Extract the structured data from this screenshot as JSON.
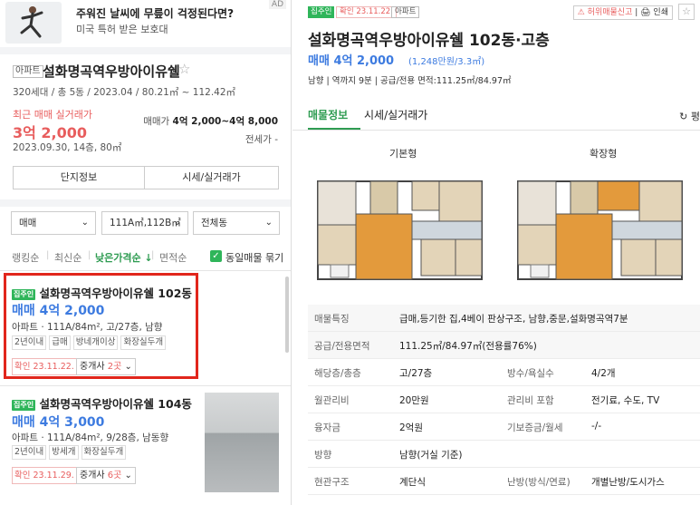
{
  "ad": {
    "badge": "AD",
    "title": "주워진 날씨에 무릎이 걱정된다면?",
    "subtitle": "미국 특허 받은 보호대"
  },
  "complex": {
    "type": "아파트",
    "name": "설화명곡역우방아이유쉘",
    "star": "☆",
    "info": "320세대 / 총 5동 / 2023.04 / 80.21㎡ ~ 112.42㎡",
    "recent_label": "최근 매매 실거래가",
    "recent_price": "3억 2,000",
    "recent_date": "2023.09.30, 14층, 80㎡",
    "maemae_label": "매매가",
    "maemae_value": "4억 2,000~4억 8,000",
    "jeonse": "전세가 -",
    "btn_info": "단지정보",
    "btn_price": "시세/실거래가"
  },
  "filters": [
    {
      "label": "매매",
      "chev": "⌄"
    },
    {
      "label": "111A㎡,112B㎡",
      "chev": "⌄"
    },
    {
      "label": "전체동",
      "chev": "⌄"
    }
  ],
  "sort": {
    "ranking": "랭킹순",
    "latest": "최신순",
    "low_price": "낮은가격순 ↓",
    "area": "면적순",
    "check": "✓",
    "group_same": "동일매물 묶기"
  },
  "listings": [
    {
      "badge": "집주인",
      "title": "설화명곡역우방아이유쉘 102동",
      "price": "매매 4억 2,000",
      "detail": "아파트 · 111A/84m², 고/27층, 남향",
      "tags": [
        "2년이내",
        "급매",
        "방네개이상",
        "화장실두개"
      ],
      "confirm": "확인 23.11.22.",
      "agent_prefix": "중개사 ",
      "agent_count": "2곳",
      "agent_suffix": " ⌄"
    },
    {
      "badge": "집주인",
      "title": "설화명곡역우방아이유쉘 104동",
      "price": "매매 4억 3,000",
      "detail": "아파트 · 111A/84m², 9/28층, 남동향",
      "tags": [
        "2년이내",
        "방세개",
        "화장실두개"
      ],
      "confirm": "확인 23.11.29.",
      "agent_prefix": "중개사 ",
      "agent_count": "6곳",
      "agent_suffix": " ⌄"
    }
  ],
  "detail": {
    "badge_owner": "집주인",
    "badge_confirm": "확인 23.11.22.",
    "badge_type": "아파트",
    "tool_report": "⚠ 허위매물신고",
    "tool_sep": " | ",
    "tool_print": "🖨 인쇄",
    "star": "☆",
    "title": "설화명곡역우방아이유쉘 102동·고층",
    "price": "매매 4억 2,000",
    "price_sub": "(1,248만원/3.3㎡)",
    "meta": "남향 | 역까지 9분 | 공급/전용 면적:111.25㎡/84.97㎡",
    "tab_info": "매물정보",
    "tab_price": "시세/실거래가",
    "refresh": "↻ 평",
    "plan_basic": "기본형",
    "plan_ext": "확장형",
    "rows": [
      {
        "k": "매물특징",
        "v": "급매,등기한 집,4베이 판상구조, 남향,중문,설화명곡역7분"
      },
      {
        "k": "공급/전용면적",
        "v": "111.25㎡/84.97㎡(전용률76%)"
      },
      {
        "k": "해당층/총층",
        "v": "고/27층",
        "k2": "방수/욕실수",
        "v2": "4/2개"
      },
      {
        "k": "월관리비",
        "v": "20만원",
        "k2": "관리비 포함",
        "v2": "전기료, 수도, TV"
      },
      {
        "k": "융자금",
        "v": "2억원",
        "k2": "기보증금/월세",
        "v2": "-/-"
      },
      {
        "k": "방향",
        "v": "남향(거실 기준)"
      },
      {
        "k": "현관구조",
        "v": "계단식",
        "k2": "난방(방식/연료)",
        "v2": "개별난방/도시가스"
      }
    ]
  },
  "colors": {
    "green": "#2fb55a",
    "blue_price": "#3d7be0",
    "red": "#e85d5d",
    "highlight": "#e1261c"
  }
}
